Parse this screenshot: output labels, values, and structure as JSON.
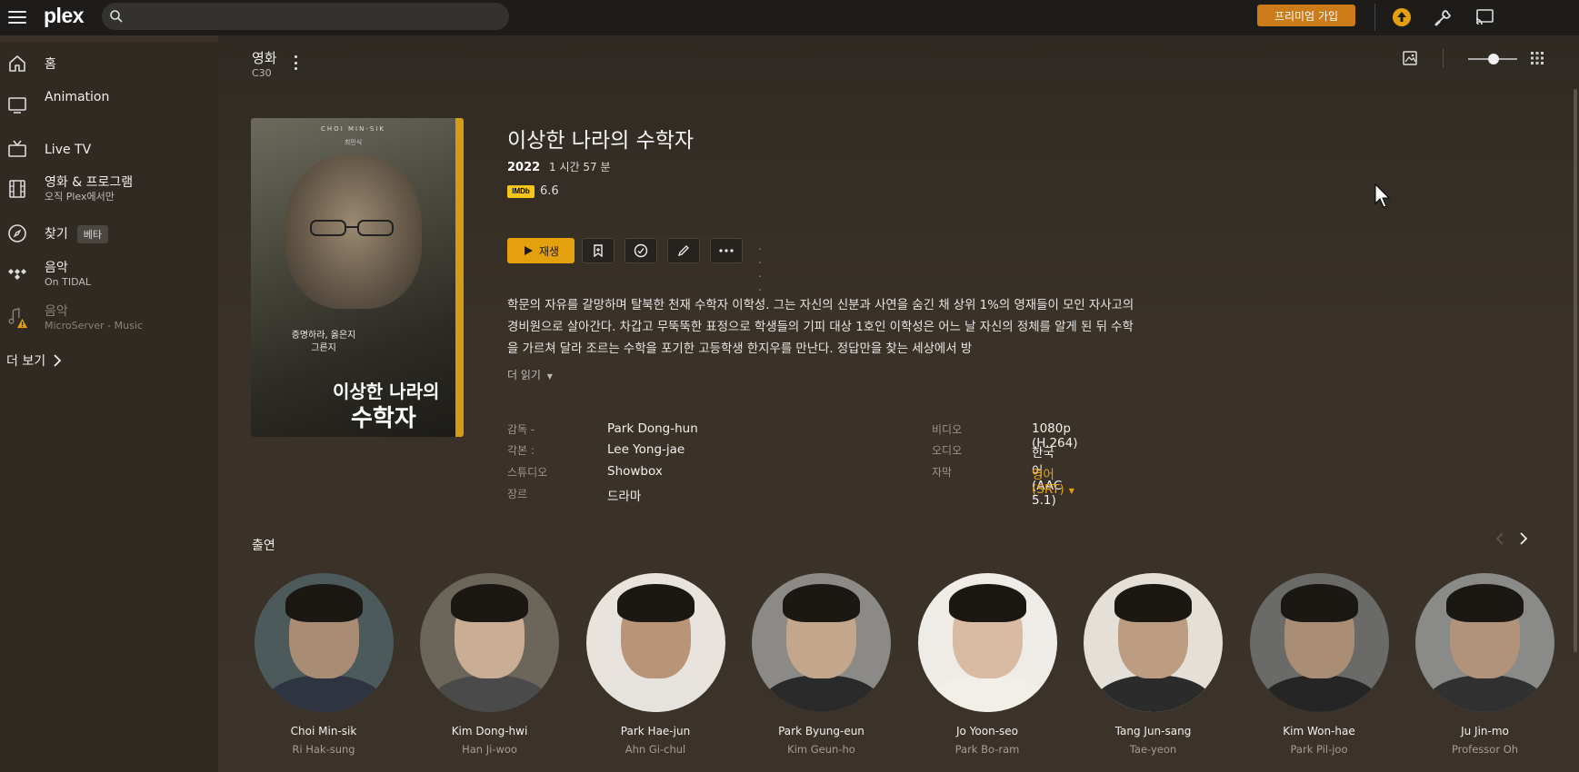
{
  "topbar": {
    "logo_text": "plex",
    "search_placeholder": "",
    "premium_label": "프리미엄 가입",
    "accent": "#e5a00d"
  },
  "sidebar": {
    "items": [
      {
        "label": "홈",
        "sub": "",
        "icon": "home-icon"
      },
      {
        "label": "Animation",
        "sub": "",
        "icon": "tv-icon"
      },
      {
        "label": "Live TV",
        "sub": "",
        "icon": "live-tv-icon"
      },
      {
        "label": "영화 & 프로그램",
        "sub": "오직 Plex에서만",
        "icon": "film-icon"
      },
      {
        "label": "찾기",
        "sub": "",
        "icon": "compass-icon",
        "badge": "베타"
      },
      {
        "label": "음악",
        "sub": "On TIDAL",
        "icon": "tidal-icon"
      },
      {
        "label": "음악",
        "sub": "MicroServer - Music",
        "icon": "music-warning-icon"
      }
    ],
    "more_label": "더 보기"
  },
  "library": {
    "title": "영화",
    "subtitle": "C30"
  },
  "poster": {
    "top_line": "CHOI MIN-SIK",
    "top_line2": "최민식",
    "tagline": "증명하라, 옳은지 그른지",
    "title_line1": "이상한 나라의",
    "title_line2": "수학자"
  },
  "movie": {
    "title": "이상한 나라의 수학자",
    "year": "2022",
    "duration": "1 시간 57 분",
    "imdb_logo": "IMDb",
    "imdb_rating": "6.6",
    "play_label": "재생",
    "rating_dots": "· · · · ·",
    "summary": "학문의 자유를 갈망하며 탈북한 천재 수학자 이학성. 그는 자신의 신분과 사연을 숨긴 채 상위 1%의 영재들이 모인 자사고의 경비원으로 살아간다. 차갑고 무뚝뚝한 표정으로 학생들의 기피 대상 1호인 이학성은 어느 날 자신의 정체를 알게 된 뒤 수학을 가르쳐 달라 조르는 수학을 포기한 고등학생 한지우를 만난다. 정답만을 찾는 세상에서 방",
    "read_more": "더 읽기"
  },
  "details": {
    "left": [
      {
        "label": "감독 -",
        "value": "Park Dong-hun"
      },
      {
        "label": "각본 :",
        "value": "Lee Yong-jae"
      },
      {
        "label": "스튜디오",
        "value": "Showbox"
      },
      {
        "label": "장르",
        "value": "드라마"
      }
    ],
    "right": [
      {
        "label": "비디오",
        "value": "1080p (H.264)"
      },
      {
        "label": "오디오",
        "value": "한국어 (AAC 5.1)"
      },
      {
        "label": "자막",
        "value": "영어 (SRT)"
      }
    ]
  },
  "cast": {
    "heading": "출연",
    "members": [
      {
        "name": "Choi Min-sik",
        "role": "Ri Hak-sung",
        "bg": "#4d5a5c"
      },
      {
        "name": "Kim Dong-hwi",
        "role": "Han Ji-woo",
        "bg": "#6b6659"
      },
      {
        "name": "Park Hae-jun",
        "role": "Ahn Gi-chul",
        "bg": "#e8e4dd"
      },
      {
        "name": "Park Byung-eun",
        "role": "Kim Geun-ho",
        "bg": "#8b8a86"
      },
      {
        "name": "Jo Yoon-seo",
        "role": "Park Bo-ram",
        "bg": "#efece8"
      },
      {
        "name": "Tang Jun-sang",
        "role": "Tae-yeon",
        "bg": "#e4e0d8"
      },
      {
        "name": "Kim Won-hae",
        "role": "Park Pil-joo",
        "bg": "#6a6a68"
      },
      {
        "name": "Ju Jin-mo",
        "role": "Professor Oh",
        "bg": "#8a8a88"
      }
    ]
  }
}
